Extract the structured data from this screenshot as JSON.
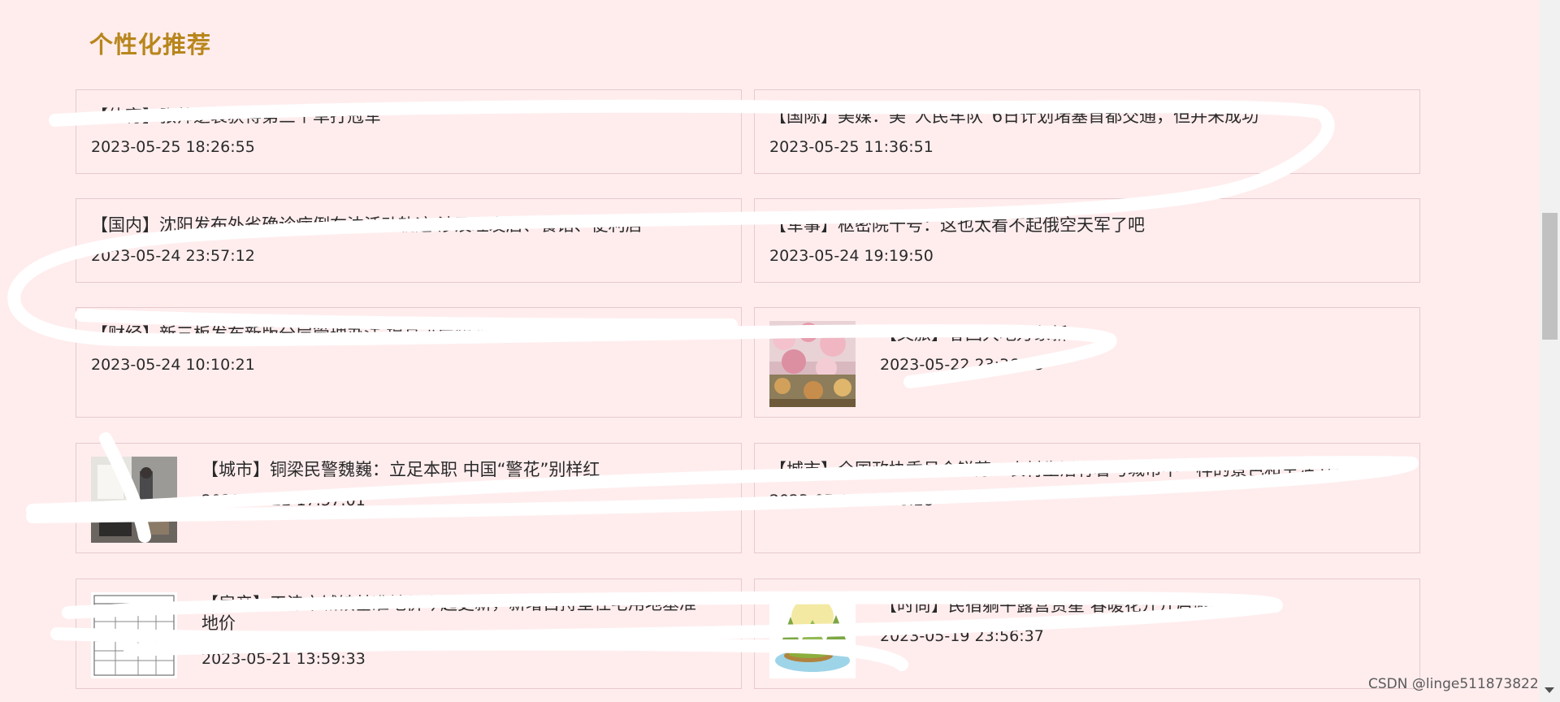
{
  "section": {
    "title": "个性化推荐"
  },
  "news": [
    {
      "title": "【体育】张帅逆袭获得第三个单打冠军",
      "time": "2023-05-25 18:26:55"
    },
    {
      "title": "【国际】美媒：美“人民车队”6日计划堵塞首都交通，但并未成功",
      "time": "2023-05-25 11:36:51"
    },
    {
      "title": "【国内】沈阳发布外省确诊病例在沈活动轨迹 涉及理发店、餐馆、便利店",
      "time": "2023-05-24 23:57:12"
    },
    {
      "title": "【军事】枢密院十号：这也太看不起俄空天军了吧",
      "time": "2023-05-24 19:19:50"
    },
    {
      "title": "【财经】新三板发布新版分层管理办法 提高进层频次 新增研发类标准",
      "time": "2023-05-24 10:10:21"
    },
    {
      "title": "【文旅】春回大地万象新",
      "time": "2023-05-22 23:36:23"
    },
    {
      "title": "【城市】铜梁民警魏巍：立足本职 中国“警花”别样红",
      "time": "2023-05-22 17:57:01"
    },
    {
      "title": "【城市】全国政协委员金锐芬：农村生活有着与城市不一样的景色和生活节奏",
      "time": "2023-05-22 16:16:28"
    },
    {
      "title": "【房产】天津市城镇基准地价今起更新，新增自持型住宅用地基准地价",
      "time": "2023-05-21 13:59:33"
    },
    {
      "title": "【时尚】民宿躺平露营赏星 春暖花开开启微度假",
      "time": "2023-05-19 23:56:37"
    }
  ],
  "watermark": "CSDN @linge511873822",
  "colors": {
    "background": "#ffedee",
    "accent": "#b8861c",
    "border": "#e7c9cc",
    "scribble": "#ffffff"
  }
}
